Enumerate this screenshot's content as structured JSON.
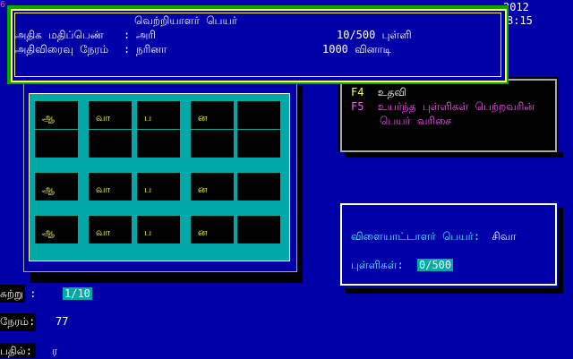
{
  "header": {
    "year": "2012",
    "time": "8:15",
    "edge_marker": "6"
  },
  "high_score_dialog": {
    "title": "வெற்றியாளர் பெயர்",
    "rows": [
      {
        "label": "அதிக மதிப்பெண்",
        "sep": ":",
        "value": "அரி",
        "score": "10/500 புள்ளி"
      },
      {
        "label": "அதிவிரைவு நேரம்",
        "sep": ":",
        "value": "நரினா",
        "score": "1000 வினாடி"
      }
    ]
  },
  "grid": {
    "rows": [
      [
        "ஆ",
        "வா",
        "ப",
        "ன",
        ""
      ],
      [
        "",
        "",
        "",
        "",
        ""
      ],
      [
        "ஆ",
        "வா",
        "ப",
        "ன",
        ""
      ],
      [
        "ஆ",
        "வா",
        "ப",
        "ன",
        ""
      ]
    ]
  },
  "help": {
    "items": [
      {
        "key": "F4",
        "text": "உதவி"
      },
      {
        "key": "F5",
        "text": "உயர்ந்த புள்ளிகள் பெற்றவரின்",
        "text2": "பெயர் வரிசை"
      }
    ]
  },
  "player": {
    "name_label": "விளையாட்டாளர் பெயர்:",
    "name_value": "சிவா",
    "points_label": "புள்ளிகள்:",
    "points_value": "0/500"
  },
  "status": {
    "round_label": "சுற்று :",
    "round_value": "1/10",
    "time_label": "நேரம்:",
    "time_value": "77",
    "answer_label": "பதில்:",
    "answer_value": "ர"
  }
}
